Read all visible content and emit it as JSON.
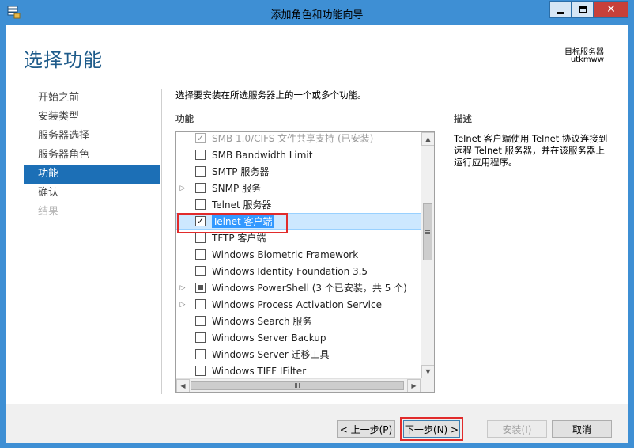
{
  "window": {
    "title": "添加角色和功能向导",
    "close_glyph": "✕"
  },
  "header": {
    "page_title": "选择功能",
    "destination_label": "目标服务器",
    "destination_server": "utkmww"
  },
  "nav": {
    "items": [
      {
        "label": "开始之前",
        "state": "normal"
      },
      {
        "label": "安装类型",
        "state": "normal"
      },
      {
        "label": "服务器选择",
        "state": "normal"
      },
      {
        "label": "服务器角色",
        "state": "normal"
      },
      {
        "label": "功能",
        "state": "active"
      },
      {
        "label": "确认",
        "state": "normal"
      },
      {
        "label": "结果",
        "state": "disabled"
      }
    ]
  },
  "main": {
    "instruction": "选择要安装在所选服务器上的一个或多个功能。",
    "features_label": "功能",
    "description_label": "描述",
    "description_text": "Telnet 客户端使用 Telnet 协议连接到远程 Telnet 服务器，并在该服务器上运行应用程序。",
    "features": [
      {
        "label": "SMB 1.0/CIFS 文件共享支持 (已安装)",
        "check": "checked-grey",
        "expandable": false,
        "dim": true
      },
      {
        "label": "SMB Bandwidth Limit",
        "check": "none",
        "expandable": false
      },
      {
        "label": "SMTP 服务器",
        "check": "none",
        "expandable": false
      },
      {
        "label": "SNMP 服务",
        "check": "none",
        "expandable": true
      },
      {
        "label": "Telnet 服务器",
        "check": "none",
        "expandable": false
      },
      {
        "label": "Telnet 客户端",
        "check": "checked",
        "expandable": false,
        "selected": true
      },
      {
        "label": "TFTP 客户端",
        "check": "none",
        "expandable": false
      },
      {
        "label": "Windows Biometric Framework",
        "check": "none",
        "expandable": false
      },
      {
        "label": "Windows Identity Foundation 3.5",
        "check": "none",
        "expandable": false
      },
      {
        "label": "Windows PowerShell (3 个已安装，共 5 个)",
        "check": "partial",
        "expandable": true
      },
      {
        "label": "Windows Process Activation Service",
        "check": "none",
        "expandable": true
      },
      {
        "label": "Windows Search 服务",
        "check": "none",
        "expandable": false
      },
      {
        "label": "Windows Server Backup",
        "check": "none",
        "expandable": false
      },
      {
        "label": "Windows Server 迁移工具",
        "check": "none",
        "expandable": false
      },
      {
        "label": "Windows TIFF IFilter",
        "check": "none",
        "expandable": false
      }
    ]
  },
  "footer": {
    "prev_label": "< 上一步(P)",
    "next_label": "下一步(N) >",
    "install_label": "安装(I)",
    "cancel_label": "取消"
  },
  "colors": {
    "frame": "#3e8fd4",
    "accent": "#1c6fb6",
    "highlight_box": "#e12b2b"
  }
}
